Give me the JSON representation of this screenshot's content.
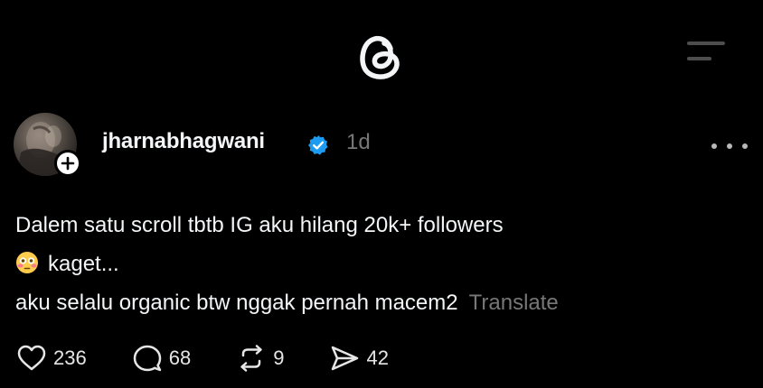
{
  "header": {
    "logo_icon": "threads-logo-icon",
    "menu_icon": "hamburger-menu-icon"
  },
  "post": {
    "author": "jharnabhagwani",
    "verified": true,
    "verified_color": "#1d9bf0",
    "timestamp": "1d",
    "text_line_1": "Dalem satu scroll tbtb IG aku hilang 20k+ followers",
    "text_line_2_emoji": "flushed-face-emoji",
    "text_line_2": "kaget...",
    "text_line_3": "aku selalu organic btw nggak pernah macem2",
    "translate_label": "Translate"
  },
  "actions": {
    "likes": "236",
    "comments": "68",
    "reposts": "9",
    "shares": "42"
  },
  "colors": {
    "background": "#000000",
    "primary_text": "#f3f5f7",
    "secondary_text": "#777777"
  }
}
